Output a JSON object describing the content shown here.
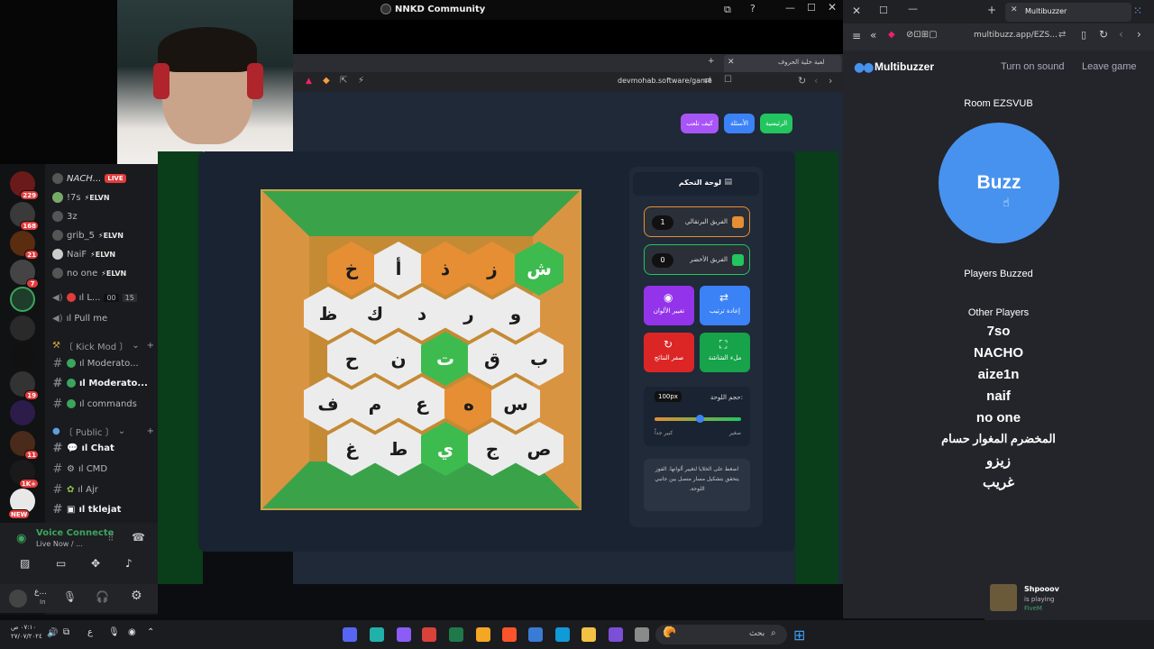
{
  "browser": {
    "window_title": "NNKD Community",
    "tab_title": "لعبة خلية الحروف",
    "url": "devmohab.software/game"
  },
  "game": {
    "nav": {
      "home": "الرئيسية",
      "questions": "الأسئلة",
      "how_to_play": "كيف تلعب"
    },
    "board_rows": [
      [
        {
          "l": "خ",
          "c": "o"
        },
        {
          "l": "أ",
          "c": "w"
        },
        {
          "l": "ذ",
          "c": "o"
        },
        {
          "l": "ز",
          "c": "o"
        },
        {
          "l": "ش",
          "c": "g"
        }
      ],
      [
        {
          "l": "ظ",
          "c": "w"
        },
        {
          "l": "ك",
          "c": "w"
        },
        {
          "l": "د",
          "c": "w"
        },
        {
          "l": "ر",
          "c": "w"
        },
        {
          "l": "و",
          "c": "w"
        }
      ],
      [
        {
          "l": "ح",
          "c": "w"
        },
        {
          "l": "ن",
          "c": "w"
        },
        {
          "l": "ت",
          "c": "g"
        },
        {
          "l": "ق",
          "c": "w"
        },
        {
          "l": "ب",
          "c": "w"
        }
      ],
      [
        {
          "l": "ف",
          "c": "w"
        },
        {
          "l": "م",
          "c": "w"
        },
        {
          "l": "ع",
          "c": "w"
        },
        {
          "l": "ه",
          "c": "o"
        },
        {
          "l": "س",
          "c": "w"
        }
      ],
      [
        {
          "l": "غ",
          "c": "w"
        },
        {
          "l": "ط",
          "c": "w"
        },
        {
          "l": "ي",
          "c": "g"
        },
        {
          "l": "ج",
          "c": "w"
        },
        {
          "l": "ص",
          "c": "w"
        }
      ]
    ],
    "control_panel": {
      "title": "لوحة التحكم",
      "team_orange": {
        "name": "الفريق البرتقالي",
        "score": "1"
      },
      "team_green": {
        "name": "الفريق الأخضر",
        "score": "0"
      },
      "btn_reorder": "إعادة ترتيب",
      "btn_colors": "تغيير الألوان",
      "btn_fullscreen": "ملء الشاشة",
      "btn_reset": "صفر النتائج",
      "board_size_label": "حجم اللوحة:",
      "board_size_value": "100px",
      "slider_small": "صغير",
      "slider_large": "كبير جداً",
      "slider_level": 0.52,
      "hint": "اضغط على الخلايا لتغيير ألوانها. الفوز يتحقق بتشكيل مسار متصل بين جانبي اللوحة."
    }
  },
  "multibuzzer": {
    "window_title": "Multibuzzer",
    "url": "multibuzz.app/EZS...",
    "brand": "Multibuzzer",
    "turn_on_sound": "Turn on sound",
    "leave_game": "Leave game",
    "room": "Room EZSVUB",
    "buzz": "Buzz",
    "players_buzzed": "Players Buzzed",
    "other_players_label": "Other Players",
    "players": [
      "7so",
      "NACHO",
      "aize1n",
      "naif",
      "no one",
      "المخضرم المغوار حسام",
      "زيزو",
      "غريب"
    ]
  },
  "discord": {
    "members": [
      {
        "name": "NACH...",
        "live": "LIVE"
      },
      {
        "name": "!7s",
        "tag": "⚡ELVN"
      },
      {
        "name": "3z"
      },
      {
        "name": "grib_5",
        "tag": "⚡ELVN"
      },
      {
        "name": "NaiF",
        "tag": "⚡ELVN"
      },
      {
        "name": "no one",
        "tag": "⚡ELVN"
      }
    ],
    "voice_channel_1": {
      "name": "ıl L...",
      "count_a": "00",
      "count_b": "15"
    },
    "voice_channel_2": "ıl Pull me",
    "category_kick": "〔 Kick Mod 〕",
    "channels_kick": [
      "ıl Moderato...",
      "ıl Moderato...",
      "ıl commands"
    ],
    "category_public": "〔 Public 〕",
    "channels_public": [
      "ıl Chat",
      "ıl CMD",
      "ıl Ajr",
      "ıl tklejat"
    ],
    "server_badges": [
      "229",
      "168",
      "21",
      "7",
      "19",
      "11",
      "1K+"
    ],
    "new_label": "NEW",
    "voice_connected": "Voice Connecte",
    "voice_sub": "Live Now / ...",
    "user_name": "ع...",
    "user_status": "In"
  },
  "notification": {
    "user": "Shpooov",
    "line1": "is playing",
    "line2": "FiveM"
  },
  "taskbar": {
    "search": "بحث",
    "time": "٠٧:١٠ ص",
    "date": "٢٧/٠٧/٢٠٢٤",
    "lang": "ع"
  }
}
